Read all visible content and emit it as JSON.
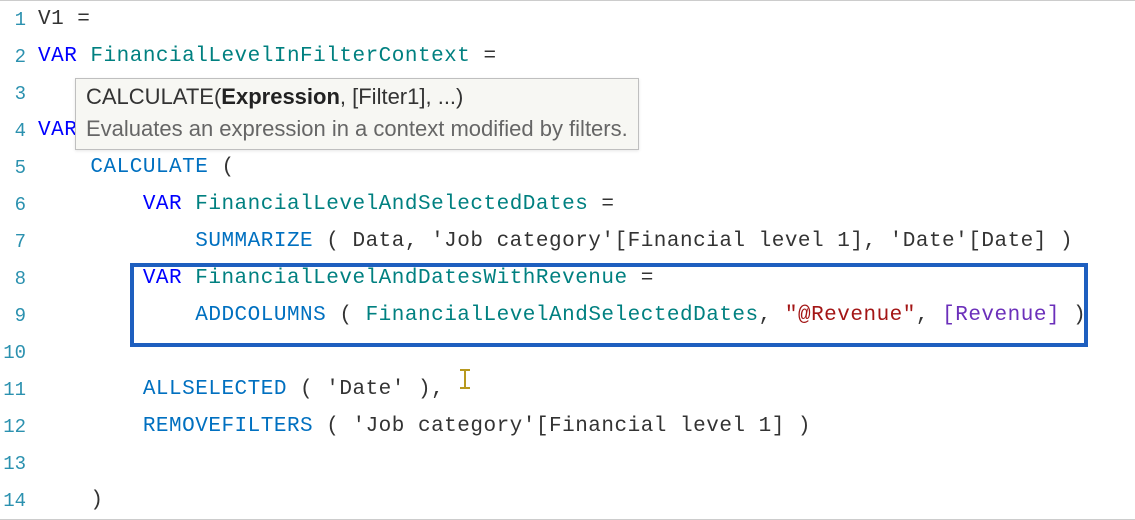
{
  "tooltip": {
    "funcName": "CALCULATE",
    "sigOpen": "(",
    "sigBold": "Expression",
    "sigRest": ", [Filter1], ...)",
    "desc": "Evaluates an expression in a context modified by filters."
  },
  "lines": {
    "l1": {
      "num": "1",
      "t1": "V1 ="
    },
    "l2": {
      "num": "2",
      "kw": "VAR",
      "name": "FinancialLevelInFilterContext",
      "eq": " ="
    },
    "l3": {
      "num": "3"
    },
    "l4": {
      "num": "4",
      "kw": "VAR"
    },
    "l5": {
      "num": "5",
      "func": "CALCULATE",
      "rest": " ("
    },
    "l6": {
      "num": "6",
      "kw": "VAR",
      "name": "FinancialLevelAndSelectedDates",
      "eq": " ="
    },
    "l7": {
      "num": "7",
      "func": "SUMMARIZE",
      "rest": " ( Data, 'Job category'[Financial level 1], 'Date'[Date] )"
    },
    "l8": {
      "num": "8",
      "kw": "VAR",
      "name": "FinancialLevelAndDatesWithRevenue",
      "eq": " ="
    },
    "l9": {
      "num": "9",
      "func": "ADDCOLUMNS",
      "open": " ( ",
      "arg1": "FinancialLevelAndSelectedDates",
      "comma1": ", ",
      "str": "\"@Revenue\"",
      "comma2": ", ",
      "meas": "[Revenue]",
      "close": " )"
    },
    "l10": {
      "num": "10"
    },
    "l11": {
      "num": "11",
      "func": "ALLSELECTED",
      "rest": " ( 'Date' ),"
    },
    "l12": {
      "num": "12",
      "func": "REMOVEFILTERS",
      "rest": " ( 'Job category'[Financial level 1] )"
    },
    "l13": {
      "num": "13"
    },
    "l14": {
      "num": "14",
      "t1": ")"
    }
  }
}
